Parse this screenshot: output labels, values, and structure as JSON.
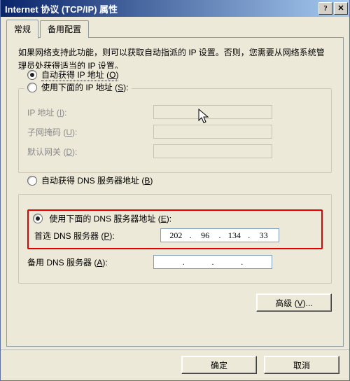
{
  "window": {
    "title": "Internet 协议 (TCP/IP) 属性"
  },
  "tabs": {
    "general": "常规",
    "alternate": "备用配置"
  },
  "description": "如果网络支持此功能，则可以获取自动指派的 IP 设置。否则，您需要从网络系统管理员处获得适当的 IP 设置。",
  "ip": {
    "autoLabelPrefix": "自动获得 IP 地址",
    "autoHotkey": "O",
    "manualLabelPrefix": "使用下面的 IP 地址",
    "manualHotkey": "S",
    "ipAddrLabel": "IP 地址",
    "ipAddrHotkey": "I",
    "subnetLabel": "子网掩码",
    "subnetHotkey": "U",
    "gatewayLabel": "默认网关",
    "gatewayHotkey": "D"
  },
  "dns": {
    "autoLabelPrefix": "自动获得 DNS 服务器地址",
    "autoHotkey": "B",
    "manualLabelPrefix": "使用下面的 DNS 服务器地址",
    "manualHotkey": "E",
    "preferredLabel": "首选 DNS 服务器",
    "preferredHotkey": "P",
    "preferred": {
      "o1": "202",
      "o2": "96",
      "o3": "134",
      "o4": "33"
    },
    "altLabel": "备用 DNS 服务器",
    "altHotkey": "A"
  },
  "buttons": {
    "advancedPrefix": "高级",
    "advancedHotkey": "V",
    "advancedSuffix": "...",
    "ok": "确定",
    "cancel": "取消"
  }
}
